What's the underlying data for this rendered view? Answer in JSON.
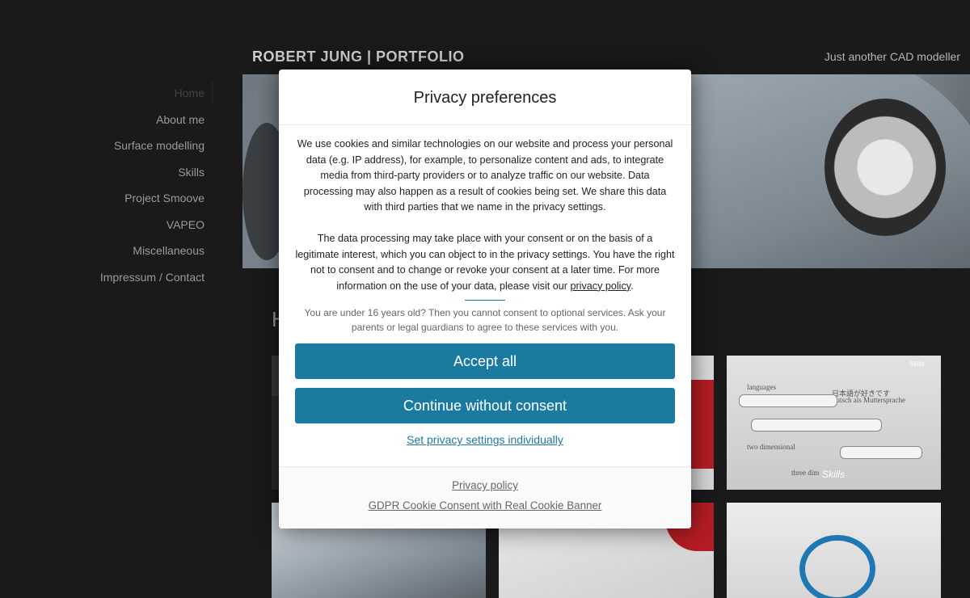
{
  "site": {
    "title": "ROBERT JUNG | PORTFOLIO",
    "tagline": "Just another CAD modeller"
  },
  "nav": {
    "items": [
      {
        "label": "Home",
        "active": true
      },
      {
        "label": "About me"
      },
      {
        "label": "Surface modelling"
      },
      {
        "label": "Skills"
      },
      {
        "label": "Project Smoove"
      },
      {
        "label": "VAPEO"
      },
      {
        "label": "Miscellaneous"
      },
      {
        "label": "Impressum / Contact"
      }
    ]
  },
  "main": {
    "section_heading_partial": "H",
    "tiles": {
      "skills_caption": "Skills",
      "skills_tag": "Skills",
      "skills_words": [
        "languages",
        "two dimensional",
        "three dim",
        "Deutsch als Muttersprache",
        "日本語が好きです"
      ]
    }
  },
  "modal": {
    "title": "Privacy preferences",
    "paragraph1": "We use cookies and similar technologies on our website and process your personal data (e.g. IP address), for example, to personalize content and ads, to integrate media from third-party providers or to analyze traffic on our website. Data processing may also happen as a result of cookies being set. We share this data with third parties that we name in the privacy settings.",
    "paragraph2_before_link": "The data processing may take place with your consent or on the basis of a legitimate interest, which you can object to in the privacy settings. You have the right not to consent and to change or revoke your consent at a later time. For more information on the use of your data, please visit our ",
    "paragraph2_link": "privacy policy",
    "paragraph2_after_link": ".",
    "age_notice": "You are under 16 years old? Then you cannot consent to optional services. Ask your parents or legal guardians to agree to these services with you.",
    "accept_all": "Accept all",
    "continue_without": "Continue without consent",
    "set_individually": "Set privacy settings individually",
    "footer_privacy": "Privacy policy",
    "footer_gdpr": "GDPR Cookie Consent with Real Cookie Banner"
  },
  "colors": {
    "accent": "#1b7aa0",
    "background": "#1a1a1a"
  }
}
